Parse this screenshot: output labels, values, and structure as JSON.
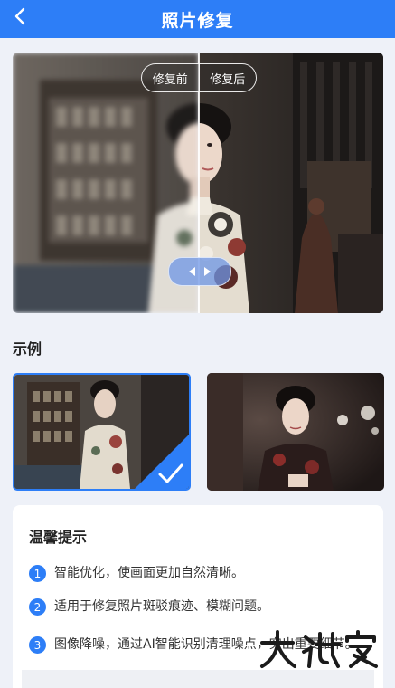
{
  "header": {
    "title": "照片修复",
    "back_icon": "chevron-left-icon"
  },
  "compare": {
    "before_label": "修复前",
    "after_label": "修复后",
    "handle_icons": [
      "arrow-left-icon",
      "arrow-right-icon"
    ]
  },
  "examples": {
    "title": "示例",
    "selected_index": 0
  },
  "tips": {
    "title": "温馨提示",
    "items": [
      {
        "number": "1",
        "text": "智能优化，使画面更加自然清晰。"
      },
      {
        "number": "2",
        "text": "适用于修复照片斑驳痕迹、模糊问题。"
      },
      {
        "number": "3",
        "text": "图像降噪，通过AI智能识别清理噪点，突出重要细节。"
      }
    ]
  },
  "colors": {
    "brand": "#2d7ef7",
    "background": "#eef1f8"
  }
}
